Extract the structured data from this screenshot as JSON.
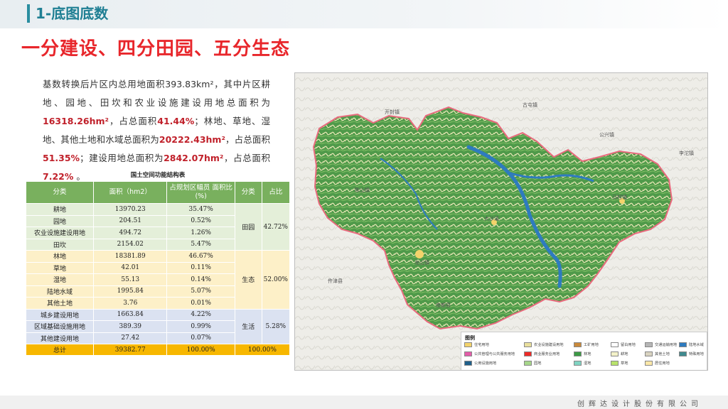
{
  "header": {
    "title": "1-底图底数"
  },
  "main_title": "一分建设、四分田园、五分生态",
  "paragraph": {
    "p1": "基数转换后片区内总用地面积393.83km²，其中片区耕地、园地、田坎和农业设施建设用地总面积为",
    "v1": "16318.26hm²",
    "p2": "，占总面积",
    "v2": "41.44%",
    "p3": "；林地、草地、湿地、其他土地和水域总面积为",
    "v3": "20222.43hm²",
    "p4": "，占总面积",
    "v4": "51.35%",
    "p5": "；建设用地总面积为",
    "v5": "2842.07hm²",
    "p6": "，占总面积",
    "v6": "7.22%",
    "p7": " 。"
  },
  "table": {
    "caption": "国土空间功能结构表",
    "headers": [
      "分类",
      "面积（hm2）",
      "占规划区幅员 面积比(%)",
      "分类",
      "占比"
    ],
    "groups": [
      {
        "name": "田园",
        "share": "42.72%",
        "rows": [
          {
            "type": "耕地",
            "area": "13970.23",
            "ratio": "35.47%"
          },
          {
            "type": "园地",
            "area": "204.51",
            "ratio": "0.52%"
          },
          {
            "type": "农业设施建设用地",
            "area": "494.72",
            "ratio": "1.26%"
          },
          {
            "type": "田坎",
            "area": "2154.02",
            "ratio": "5.47%"
          }
        ]
      },
      {
        "name": "生态",
        "share": "52.00%",
        "rows": [
          {
            "type": "林地",
            "area": "18381.89",
            "ratio": "46.67%"
          },
          {
            "type": "草地",
            "area": "42.01",
            "ratio": "0.11%"
          },
          {
            "type": "湿地",
            "area": "55.13",
            "ratio": "0.14%"
          },
          {
            "type": "陆地水域",
            "area": "1995.84",
            "ratio": "5.07%"
          },
          {
            "type": "其他土地",
            "area": "3.76",
            "ratio": "0.01%"
          }
        ]
      },
      {
        "name": "生活",
        "share": "5.28%",
        "rows": [
          {
            "type": "城乡建设用地",
            "area": "1663.84",
            "ratio": "4.22%"
          },
          {
            "type": "区域基础设施用地",
            "area": "389.39",
            "ratio": "0.99%"
          },
          {
            "type": "其他建设用地",
            "area": "27.42",
            "ratio": "0.07%"
          }
        ]
      }
    ],
    "total": {
      "label": "总计",
      "area": "39382.77",
      "ratio": "100.00%",
      "share": "100.00%"
    }
  },
  "map": {
    "places": [
      "开封镇",
      "古屯镇",
      "公兴镇",
      "李沱镇",
      "仵津县",
      "南都县",
      "龙山镇",
      "大沙溪",
      "马村镇",
      "陈山镇"
    ],
    "legend_title": "图例",
    "legend": [
      {
        "label": "住宅用地",
        "color": "#f3d36b"
      },
      {
        "label": "农业设施建设用地",
        "color": "#e9df9c"
      },
      {
        "label": "工矿用地",
        "color": "#c9893b"
      },
      {
        "label": "留白用地",
        "color": "#ffffff"
      },
      {
        "label": "交通运输用地",
        "color": "#b6b6b6"
      },
      {
        "label": "陆地水域",
        "color": "#2e7bbf"
      },
      {
        "label": "公共管理与公共服务用地",
        "color": "#e35ca9"
      },
      {
        "label": "商业服务业用地",
        "color": "#ee2a27"
      },
      {
        "label": "林地",
        "color": "#3c9a45"
      },
      {
        "label": "耕地",
        "color": "#f3f1c8"
      },
      {
        "label": "其他土地",
        "color": "#d9d3c0"
      },
      {
        "label": "特殊用地",
        "color": "#3f8a8f"
      },
      {
        "label": "公用设施用地",
        "color": "#1f5f8a"
      },
      {
        "label": "园地",
        "color": "#a6d68a"
      },
      {
        "label": "湿地",
        "color": "#7fd3c2"
      },
      {
        "label": "草地",
        "color": "#b8e26b"
      },
      {
        "label": "居住用地",
        "color": "#fbe7a8"
      }
    ]
  },
  "footer": {
    "company": "创辉达设计股份有限公司"
  },
  "colors": {
    "accent": "#1f7f93",
    "title_red": "#e8262b",
    "highlight": "#c0202a",
    "table_head": "#79b05e",
    "total_row": "#f7b700"
  }
}
